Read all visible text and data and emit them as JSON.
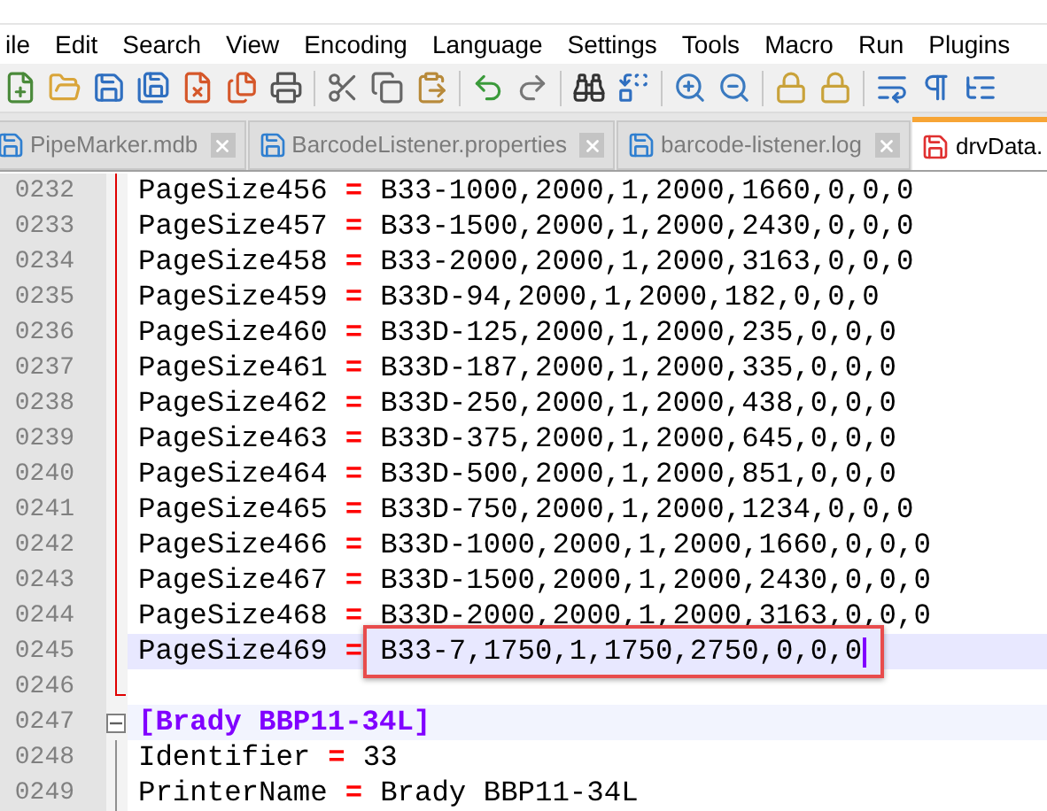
{
  "menu": [
    "ile",
    "Edit",
    "Search",
    "View",
    "Encoding",
    "Language",
    "Settings",
    "Tools",
    "Macro",
    "Run",
    "Plugins"
  ],
  "tabs": [
    {
      "label": "PipeMarker.mdb",
      "selected": false,
      "modified": false
    },
    {
      "label": "BarcodeListener.properties",
      "selected": false,
      "modified": false
    },
    {
      "label": "barcode-listener.log",
      "selected": false,
      "modified": false
    },
    {
      "label": "drvData.",
      "selected": true,
      "modified": true
    }
  ],
  "lines": [
    {
      "number": "0232",
      "kind": "pair",
      "key": "PageSize456",
      "eq": "=",
      "value": "B33-1000,2000,1,2000,1660,0,0,0",
      "current": false,
      "highlighted": false
    },
    {
      "number": "0233",
      "kind": "pair",
      "key": "PageSize457",
      "eq": "=",
      "value": "B33-1500,2000,1,2000,2430,0,0,0",
      "current": false,
      "highlighted": false
    },
    {
      "number": "0234",
      "kind": "pair",
      "key": "PageSize458",
      "eq": "=",
      "value": "B33-2000,2000,1,2000,3163,0,0,0",
      "current": false,
      "highlighted": false
    },
    {
      "number": "0235",
      "kind": "pair",
      "key": "PageSize459",
      "eq": "=",
      "value": "B33D-94,2000,1,2000,182,0,0,0",
      "current": false,
      "highlighted": false
    },
    {
      "number": "0236",
      "kind": "pair",
      "key": "PageSize460",
      "eq": "=",
      "value": "B33D-125,2000,1,2000,235,0,0,0",
      "current": false,
      "highlighted": false
    },
    {
      "number": "0237",
      "kind": "pair",
      "key": "PageSize461",
      "eq": "=",
      "value": "B33D-187,2000,1,2000,335,0,0,0",
      "current": false,
      "highlighted": false
    },
    {
      "number": "0238",
      "kind": "pair",
      "key": "PageSize462",
      "eq": "=",
      "value": "B33D-250,2000,1,2000,438,0,0,0",
      "current": false,
      "highlighted": false
    },
    {
      "number": "0239",
      "kind": "pair",
      "key": "PageSize463",
      "eq": "=",
      "value": "B33D-375,2000,1,2000,645,0,0,0",
      "current": false,
      "highlighted": false
    },
    {
      "number": "0240",
      "kind": "pair",
      "key": "PageSize464",
      "eq": "=",
      "value": "B33D-500,2000,1,2000,851,0,0,0",
      "current": false,
      "highlighted": false
    },
    {
      "number": "0241",
      "kind": "pair",
      "key": "PageSize465",
      "eq": "=",
      "value": "B33D-750,2000,1,2000,1234,0,0,0",
      "current": false,
      "highlighted": false
    },
    {
      "number": "0242",
      "kind": "pair",
      "key": "PageSize466",
      "eq": "=",
      "value": "B33D-1000,2000,1,2000,1660,0,0,0",
      "current": false,
      "highlighted": false
    },
    {
      "number": "0243",
      "kind": "pair",
      "key": "PageSize467",
      "eq": "=",
      "value": "B33D-1500,2000,1,2000,2430,0,0,0",
      "current": false,
      "highlighted": false
    },
    {
      "number": "0244",
      "kind": "pair",
      "key": "PageSize468",
      "eq": "=",
      "value": "B33D-2000,2000,1,2000,3163,0,0,0",
      "current": false,
      "highlighted": false
    },
    {
      "number": "0245",
      "kind": "pair",
      "key": "PageSize469",
      "eq": "=",
      "value": "B33-7,1750,1,1750,2750,0,0,0",
      "current": true,
      "highlighted": true
    },
    {
      "number": "0246",
      "kind": "blank",
      "fold_end": true
    },
    {
      "number": "0247",
      "kind": "section",
      "value": "[Brady BBP11-34L]",
      "expanded": true
    },
    {
      "number": "0248",
      "kind": "pair",
      "key": "Identifier",
      "eq": "=",
      "value": "33",
      "current": false,
      "highlighted": false
    },
    {
      "number": "0249",
      "kind": "pair",
      "key": "PrinterName",
      "eq": "=",
      "value": "Brady BBP11-34L",
      "current": false,
      "highlighted": false
    }
  ]
}
